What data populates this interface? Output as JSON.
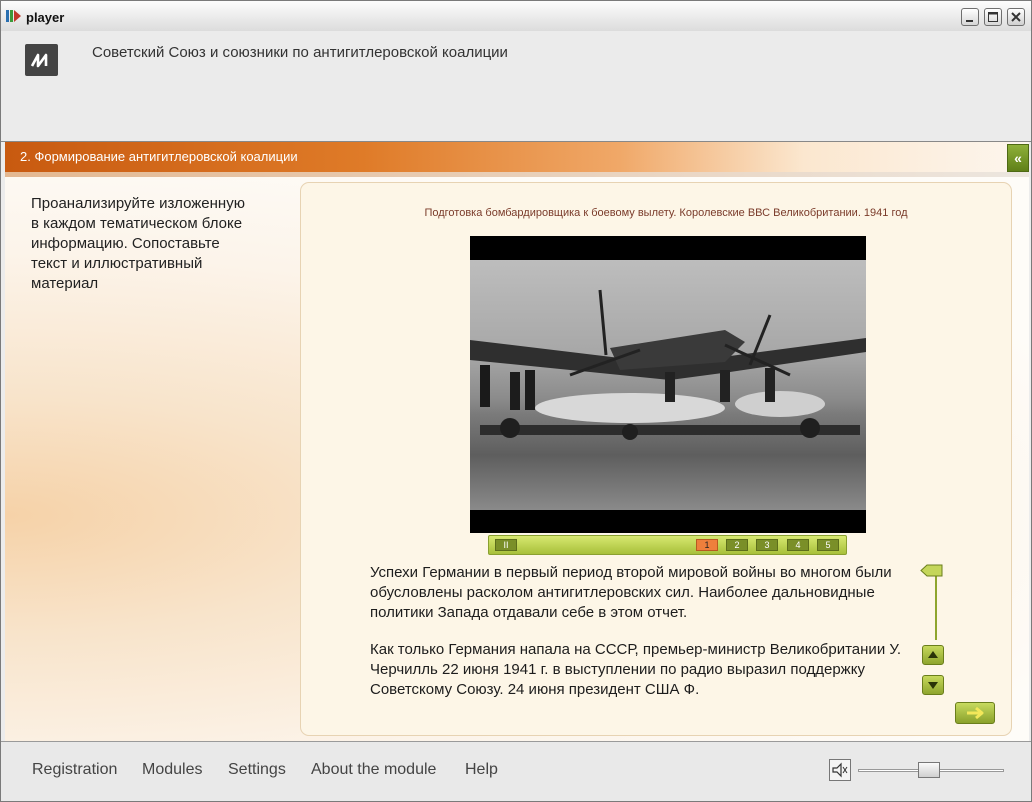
{
  "window": {
    "title": "player"
  },
  "header": {
    "title": "Советский Союз и союзники по антигитлеровской коалиции",
    "logo_icon": "course-logo-icon"
  },
  "section": {
    "title": "2. Формирование антигитлеровской коалиции",
    "collapse_glyph": "«"
  },
  "instruction": "Проанализируйте изложенную в каждом тематическом блоке информацию. Сопоставьте текст и иллюстративный материал",
  "media": {
    "caption": "Подготовка бомбардировщика к боевому вылету. Королевские ВВС Великобритании. 1941 год",
    "pause_label": "II",
    "pages": [
      "1",
      "2",
      "3",
      "4",
      "5"
    ],
    "active_page": "1"
  },
  "text": {
    "paragraphs": [
      "Успехи Германии в первый период второй мировой войны во многом были обусловлены расколом антигитлеровских сил. Наиболее дальновидные политики Запада отдавали себе в этом отчет.",
      "Как только Германия напала на СССР, премьер-министр Великобритании У. Черчилль 22 июня 1941 г. в выступлении по радио выразил поддержку Советскому Союзу. 24 июня президент США Ф."
    ]
  },
  "footer": {
    "menu": [
      "Registration",
      "Modules",
      "Settings",
      "About the module",
      "Help"
    ],
    "volume_level": 0.48
  }
}
